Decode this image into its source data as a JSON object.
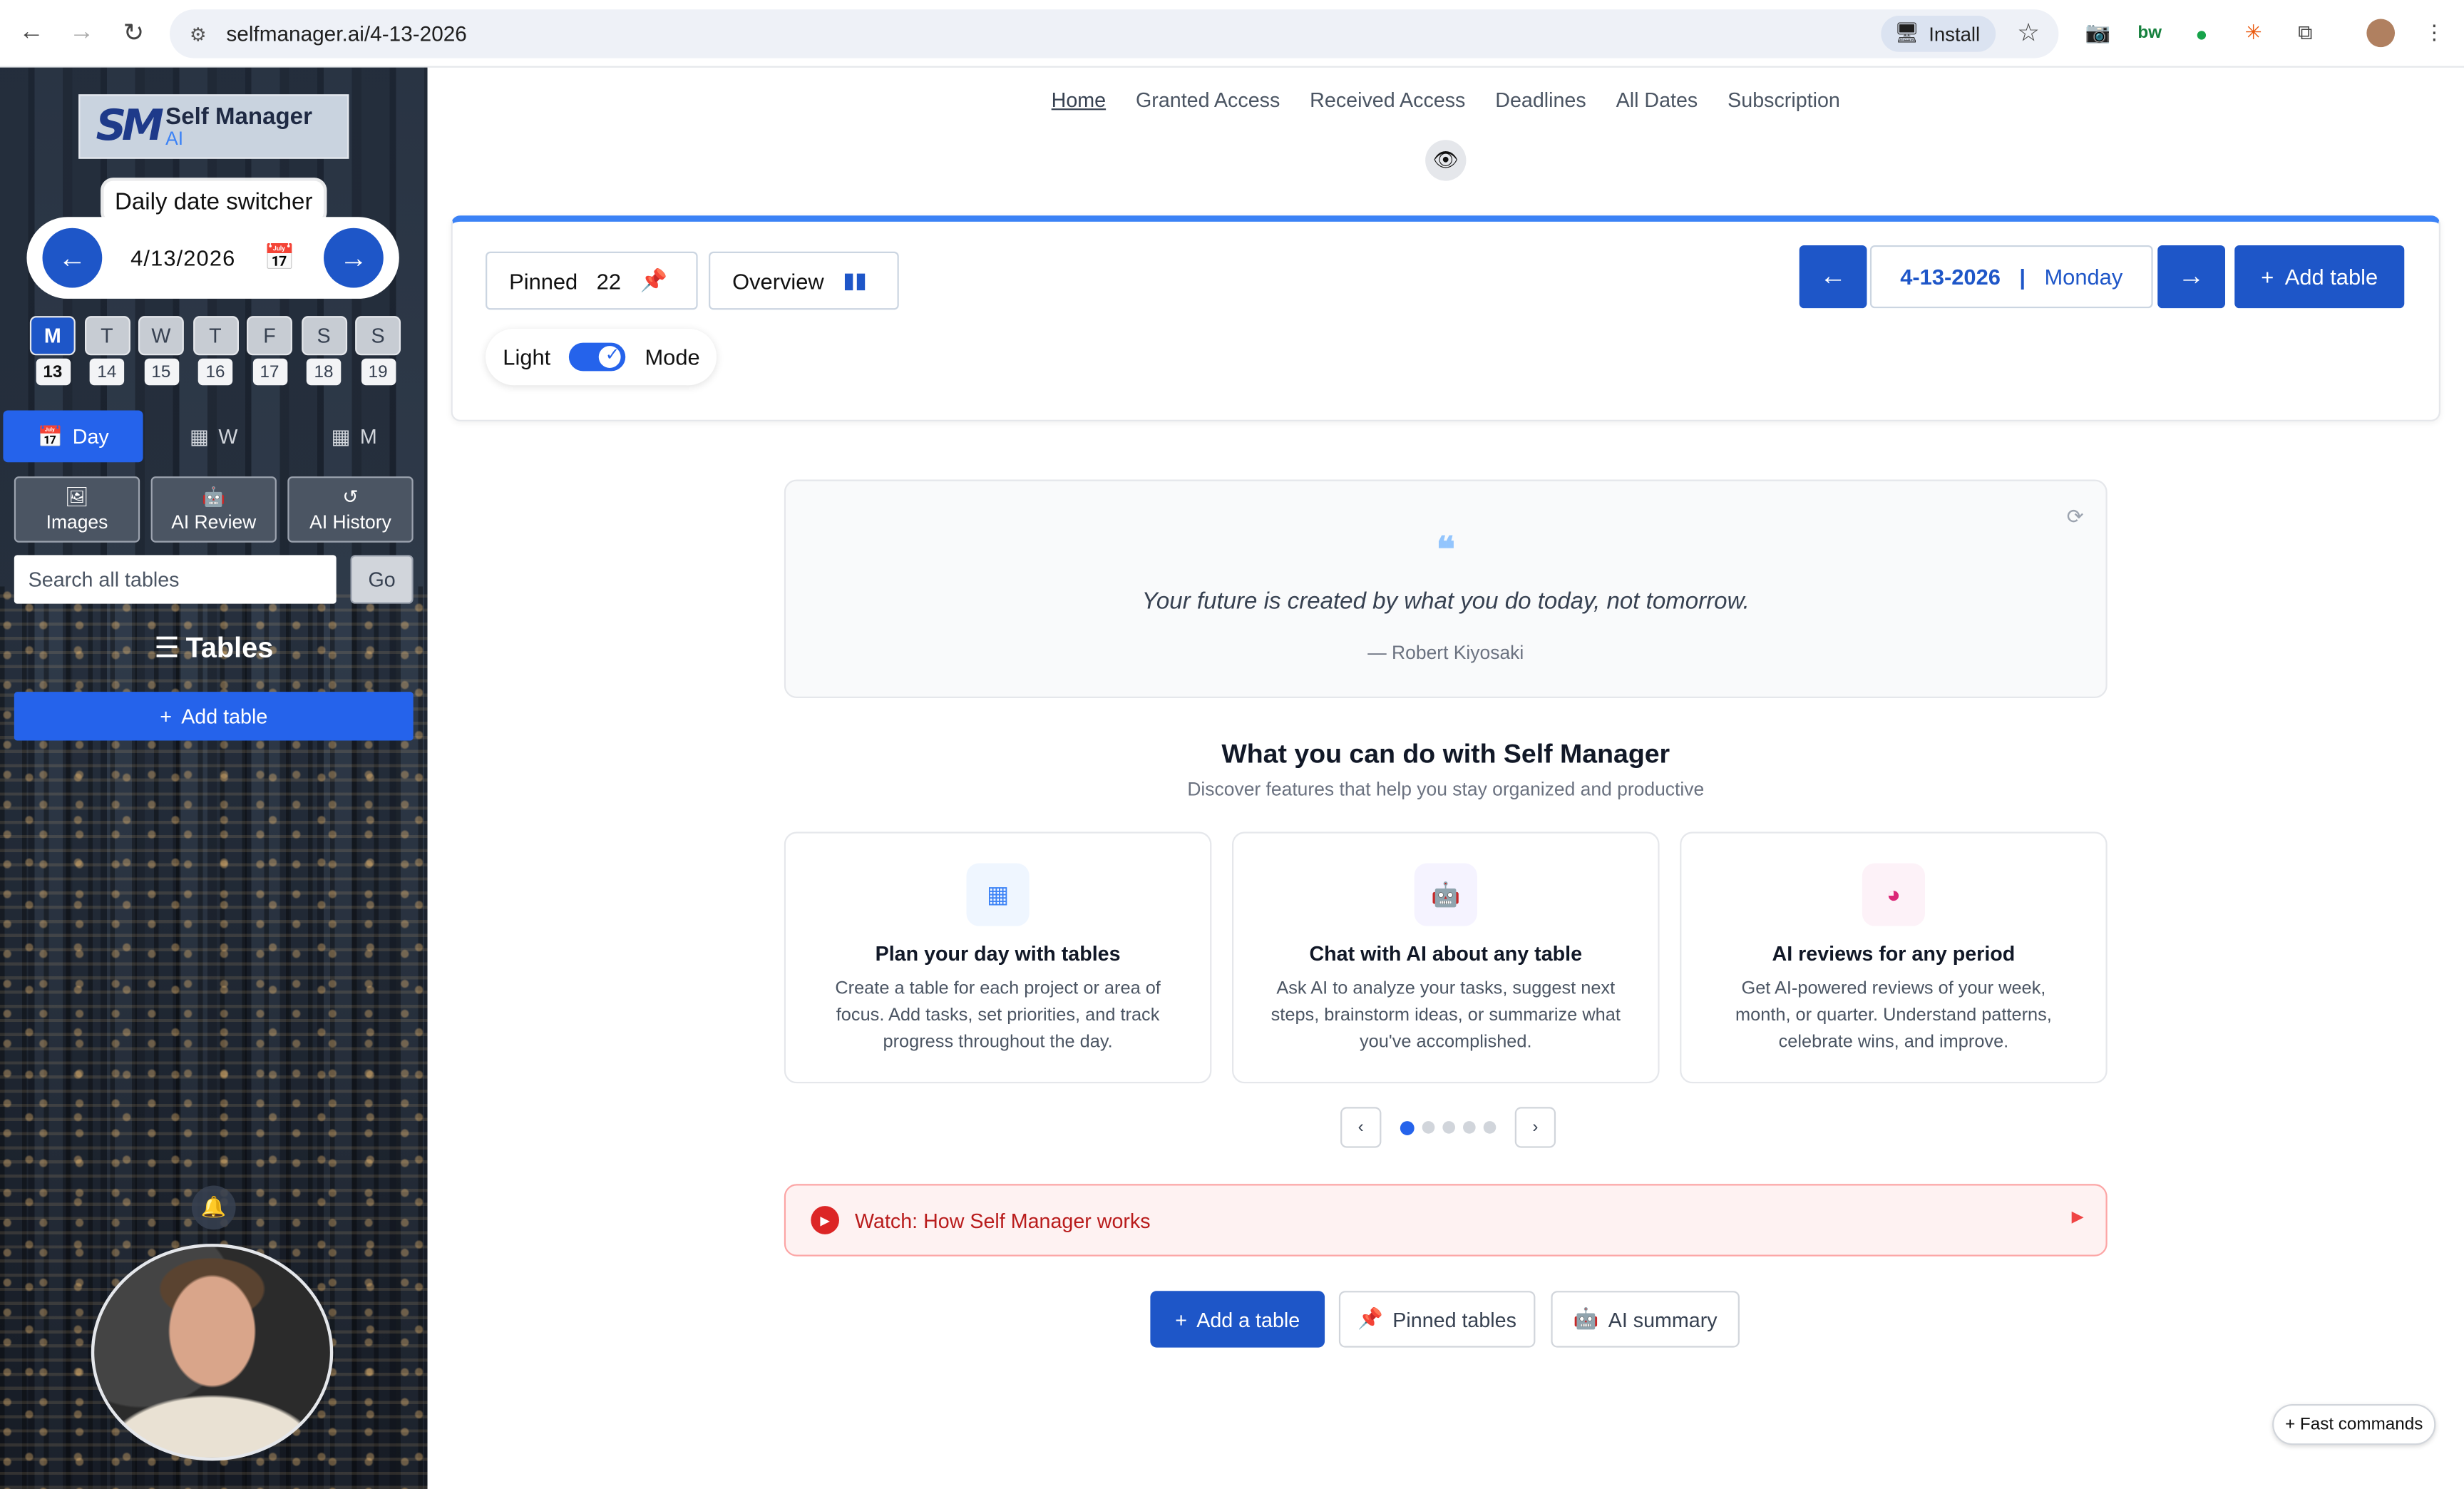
{
  "browser": {
    "url": "selfmanager.ai/4-13-2026",
    "install_label": "Install"
  },
  "sidebar": {
    "logo_mark": "SM",
    "logo_title": "Self Manager",
    "logo_sub": "AI",
    "switcher_label": "Daily date switcher",
    "current_date": "4/13/2026",
    "week": [
      {
        "letter": "M",
        "num": "13"
      },
      {
        "letter": "T",
        "num": "14"
      },
      {
        "letter": "W",
        "num": "15"
      },
      {
        "letter": "T",
        "num": "16"
      },
      {
        "letter": "F",
        "num": "17"
      },
      {
        "letter": "S",
        "num": "18"
      },
      {
        "letter": "S",
        "num": "19"
      }
    ],
    "views": {
      "day": "Day",
      "week": "W",
      "month": "M"
    },
    "tools": {
      "images": "Images",
      "ai_review": "AI Review",
      "ai_history": "AI History"
    },
    "search_placeholder": "Search all tables",
    "go_label": "Go",
    "tables_heading": "Tables",
    "add_table_label": "Add table"
  },
  "topnav": {
    "links": [
      "Home",
      "Granted Access",
      "Received Access",
      "Deadlines",
      "All Dates",
      "Subscription"
    ]
  },
  "panel": {
    "pinned_label": "Pinned",
    "pinned_count": "22",
    "overview_label": "Overview",
    "mode_left": "Light",
    "mode_right": "Mode",
    "date": "4-13-2026",
    "separator": "|",
    "weekday": "Monday",
    "add_table_label": "Add table"
  },
  "quote": {
    "text": "Your future is created by what you do today, not tomorrow.",
    "author": "— Robert Kiyosaki"
  },
  "features": {
    "title": "What you can do with Self Manager",
    "subtitle": "Discover features that help you stay organized and productive",
    "cards": [
      {
        "title": "Plan your day with tables",
        "body": "Create a table for each project or area of focus. Add tasks, set priorities, and track progress throughout the day."
      },
      {
        "title": "Chat with AI about any table",
        "body": "Ask AI to analyze your tasks, suggest next steps, brainstorm ideas, or summarize what you've accomplished."
      },
      {
        "title": "AI reviews for any period",
        "body": "Get AI-powered reviews of your week, month, or quarter. Understand patterns, celebrate wins, and improve."
      }
    ]
  },
  "watch": {
    "label": "Watch: How Self Manager works"
  },
  "bottom": {
    "add_table": "Add a table",
    "pinned_tables": "Pinned tables",
    "ai_summary": "AI summary"
  },
  "fast_commands": "Fast commands",
  "colors": {
    "accent": "#1e56c8",
    "primary_blue": "#2563eb",
    "danger": "#dc2626"
  }
}
